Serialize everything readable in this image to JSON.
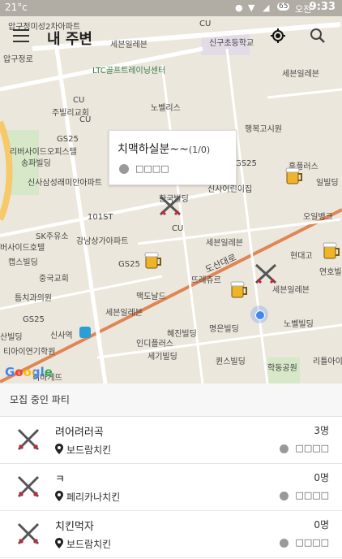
{
  "status": {
    "left": "21°c",
    "time": "9:33",
    "ampm": "오전",
    "battery": "65"
  },
  "toolbar": {
    "title": "내 주변"
  },
  "map": {
    "labels": [
      "압구정미성2차아파트",
      "압구정로",
      "세븐일레븐",
      "CU",
      "신구초등학교",
      "세븐일레븐",
      "LTC골프트레이닝센터",
      "CU",
      "노벨리스",
      "주빌리교회",
      "CU",
      "행복고시원",
      "GS25",
      "리버사이드오피스텔",
      "홈플러스",
      "송파빌딩",
      "GS25",
      "일빌딩",
      "신사삼성래미안아파트",
      "신사어린이집",
      "한국빌딩",
      "오일뱅크",
      "101ST",
      "CU",
      "SK주유소",
      "강남상가아파트",
      "세븐일레븐",
      "버사이드호텔",
      "도산대로",
      "GS25",
      "현대고",
      "연호빌딩",
      "뜨레쥬르",
      "중국교회",
      "캡스빌딩",
      "맥도날드",
      "틈치과의원",
      "세븐일레븐",
      "세븐일레븐",
      "GS25",
      "신사역",
      "혜진빌딩",
      "명은빌딩",
      "노벨빌딩",
      "산빌딩",
      "인디플러스",
      "세기빌딩",
      "티아이연기학원",
      "퀸스빌딩",
      "학동공원",
      "리틀아이",
      "리바게뜨"
    ],
    "google": "Google",
    "popup": {
      "title": "치맥하실분~~",
      "count": "(1/0)",
      "user": "□□□□"
    }
  },
  "list": {
    "header": "모집 중인 파티",
    "items": [
      {
        "name": "려어려러곡",
        "place": "보드람치킨",
        "count": "3명",
        "user": "□□□□"
      },
      {
        "name": "ㅋ",
        "place": "페리카나치킨",
        "count": "0명",
        "user": "□□□□"
      },
      {
        "name": "치킨먹자",
        "place": "보드람치킨",
        "count": "0명",
        "user": "□□□□"
      }
    ]
  },
  "colors": {
    "road_main": "#e08555",
    "road_yellow": "#f6c96a",
    "park": "#d6e8c8",
    "pin": "#4285f4"
  }
}
